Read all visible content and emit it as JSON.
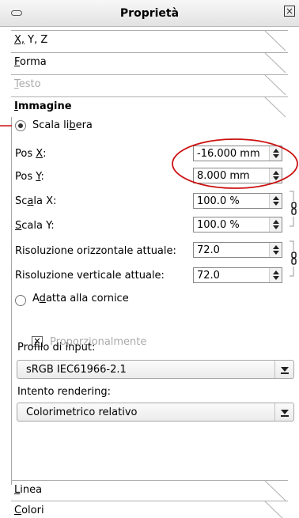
{
  "window": {
    "title": "Proprietà",
    "close_symbol": "×"
  },
  "tabs": {
    "xyz": "X, Y, Z",
    "forma": "Forma",
    "testo": "Testo",
    "immagine": "Immagine",
    "linea": "Linea",
    "colori": "Colori"
  },
  "image": {
    "scala_libera": {
      "pre": "Scala li",
      "u": "b",
      "post": "era"
    },
    "pos_x": {
      "pre": "Pos ",
      "u": "X",
      "post": ":",
      "value": "-16.000 mm"
    },
    "pos_y": {
      "pre": "Pos ",
      "u": "Y",
      "post": ":",
      "value": "8.000 mm"
    },
    "scala_x": {
      "pre": "Sc",
      "u": "a",
      "post": "la X:",
      "value": "100.0 %"
    },
    "scala_y": {
      "pre": "",
      "u": "S",
      "post": "cala Y:",
      "value": "100.0 %"
    },
    "ris_orizz": {
      "label": "Risoluzione orizzontale attuale:",
      "value": "72.0"
    },
    "ris_vert": {
      "label": "Risoluzione verticale attuale:",
      "value": "72.0"
    },
    "adatta": {
      "pre": "A",
      "u": "d",
      "post": "atta alla cornice"
    },
    "proporzionalmente": {
      "pre": "P",
      "u": "r",
      "post": "oporzionalmente"
    },
    "profilo_label": "Profilo di input:",
    "profilo_value": "sRGB IEC61966-2.1",
    "intento_label": "Intento rendering:",
    "intento_value": "Colorimetrico relativo"
  },
  "state": {
    "scala_libera_selected": true,
    "adatta_selected": false,
    "proporzionalmente_checked": true,
    "proporzionalmente_enabled": false
  },
  "colors": {
    "annotation": "#cc1111",
    "disabled_text": "#aaaaaa"
  }
}
